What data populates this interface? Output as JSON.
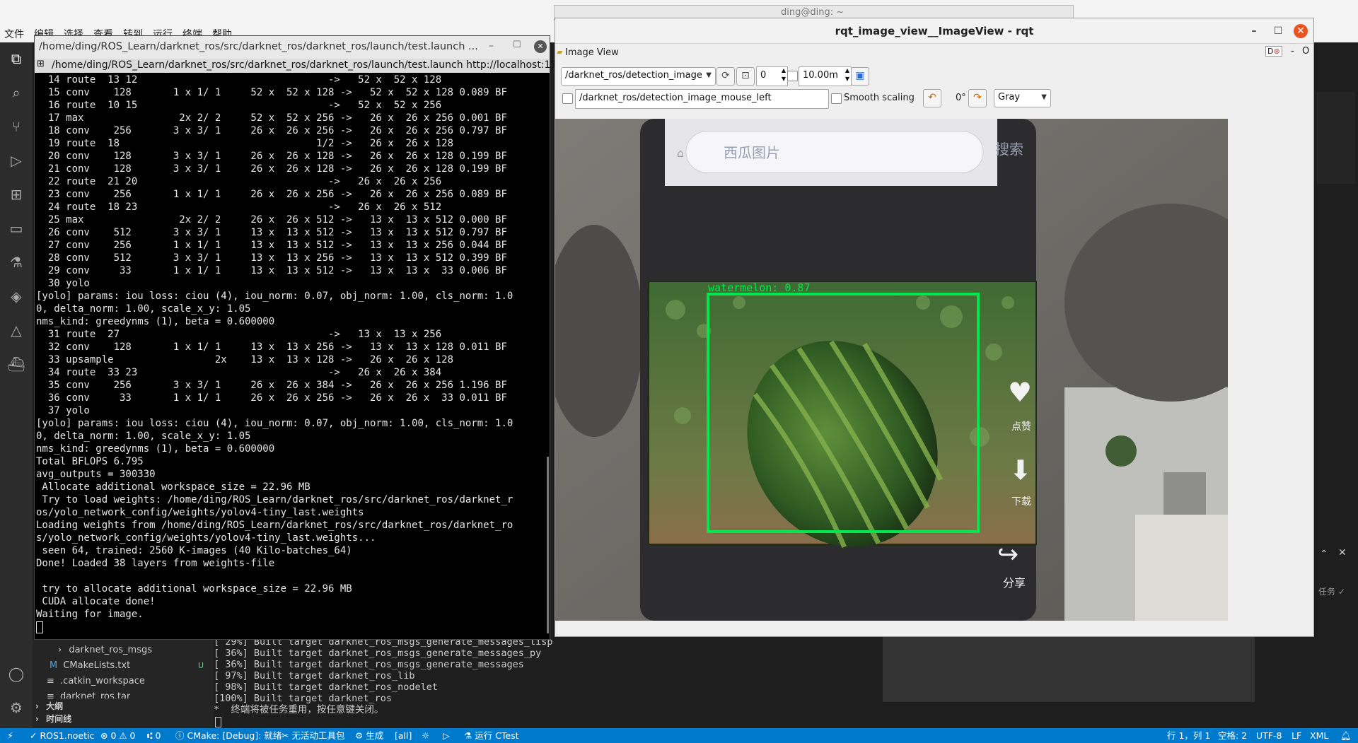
{
  "vscode": {
    "menu": [
      "文件",
      "编辑",
      "选择",
      "查看",
      "转到",
      "运行",
      "终端",
      "帮助"
    ],
    "background_title": "ding@ding: ~",
    "explorer": {
      "items": [
        "darknet_ros_msgs",
        "CMakeLists.txt",
        ".catkin_workspace",
        "darknet_ros.tar"
      ],
      "cmake_badge": "U",
      "sections": [
        "大纲",
        "时间线"
      ]
    },
    "panel_lines": [
      "[ 29%] Built target darknet_ros_msgs_generate_messages_lisp",
      "[ 36%] Built target darknet_ros_msgs_generate_messages_py",
      "[ 36%] Built target darknet_ros_msgs_generate_messages",
      "[ 97%] Built target darknet_ros_lib",
      "[ 98%] Built target darknet_ros_nodelet",
      "[100%] Built target darknet_ros",
      "*  终端将被任务重用，按任意键关闭。"
    ],
    "side_labels": {
      "task": "任务"
    },
    "status": {
      "remote": "⚡",
      "env": "ROS1.noetic",
      "problems": "⊗ 0 ⚠ 0",
      "ports": "⑆ 0",
      "cmake": "CMake: [Debug]: 就绪",
      "kit": "无活动工具包",
      "build": "生成",
      "target": "[all]",
      "ctest": "运行 CTest",
      "position": "行 1，列 1",
      "spaces": "空格: 2",
      "encoding": "UTF-8",
      "eol": "LF",
      "language": "XML"
    }
  },
  "terminal": {
    "title": "/home/ding/ROS_Learn/darknet_ros/src/darknet_ros/darknet_ros/launch/test.launch ...",
    "tab_text": "/home/ding/ROS_Learn/darknet_ros/src/darknet_ros/darknet_ros/launch/test.launch http://localhost:11",
    "lines": [
      "  14 route  13 12                                ->   52 x  52 x 128",
      "  15 conv    128       1 x 1/ 1     52 x  52 x 128 ->   52 x  52 x 128 0.089 BF",
      "  16 route  10 15                                ->   52 x  52 x 256",
      "  17 max                2x 2/ 2     52 x  52 x 256 ->   26 x  26 x 256 0.001 BF",
      "  18 conv    256       3 x 3/ 1     26 x  26 x 256 ->   26 x  26 x 256 0.797 BF",
      "  19 route  18                                 1/2 ->   26 x  26 x 128",
      "  20 conv    128       3 x 3/ 1     26 x  26 x 128 ->   26 x  26 x 128 0.199 BF",
      "  21 conv    128       3 x 3/ 1     26 x  26 x 128 ->   26 x  26 x 128 0.199 BF",
      "  22 route  21 20                                ->   26 x  26 x 256",
      "  23 conv    256       1 x 1/ 1     26 x  26 x 256 ->   26 x  26 x 256 0.089 BF",
      "  24 route  18 23                                ->   26 x  26 x 512",
      "  25 max                2x 2/ 2     26 x  26 x 512 ->   13 x  13 x 512 0.000 BF",
      "  26 conv    512       3 x 3/ 1     13 x  13 x 512 ->   13 x  13 x 512 0.797 BF",
      "  27 conv    256       1 x 1/ 1     13 x  13 x 512 ->   13 x  13 x 256 0.044 BF",
      "  28 conv    512       3 x 3/ 1     13 x  13 x 256 ->   13 x  13 x 512 0.399 BF",
      "  29 conv     33       1 x 1/ 1     13 x  13 x 512 ->   13 x  13 x  33 0.006 BF",
      "  30 yolo",
      "[yolo] params: iou loss: ciou (4), iou_norm: 0.07, obj_norm: 1.00, cls_norm: 1.0",
      "0, delta_norm: 1.00, scale_x_y: 1.05",
      "nms_kind: greedynms (1), beta = 0.600000",
      "  31 route  27                                   ->   13 x  13 x 256",
      "  32 conv    128       1 x 1/ 1     13 x  13 x 256 ->   13 x  13 x 128 0.011 BF",
      "  33 upsample                 2x    13 x  13 x 128 ->   26 x  26 x 128",
      "  34 route  33 23                                ->   26 x  26 x 384",
      "  35 conv    256       3 x 3/ 1     26 x  26 x 384 ->   26 x  26 x 256 1.196 BF",
      "  36 conv     33       1 x 1/ 1     26 x  26 x 256 ->   26 x  26 x  33 0.011 BF",
      "  37 yolo",
      "[yolo] params: iou loss: ciou (4), iou_norm: 0.07, obj_norm: 1.00, cls_norm: 1.0",
      "0, delta_norm: 1.00, scale_x_y: 1.05",
      "nms_kind: greedynms (1), beta = 0.600000",
      "Total BFLOPS 6.795",
      "avg_outputs = 300330",
      " Allocate additional workspace_size = 22.96 MB",
      " Try to load weights: /home/ding/ROS_Learn/darknet_ros/src/darknet_ros/darknet_r",
      "os/yolo_network_config/weights/yolov4-tiny_last.weights",
      "Loading weights from /home/ding/ROS_Learn/darknet_ros/src/darknet_ros/darknet_ro",
      "s/yolo_network_config/weights/yolov4-tiny_last.weights...",
      " seen 64, trained: 2560 K-images (40 Kilo-batches_64)",
      "Done! Loaded 38 layers from weights-file",
      "",
      " try to allocate additional workspace_size = 22.96 MB",
      " CUDA allocate done!",
      "Waiting for image."
    ]
  },
  "rqt": {
    "title": "rqt_image_view__ImageView - rqt",
    "plugin_label": "Image View",
    "plugin_controls": "D",
    "topic": "/darknet_ros/detection_image",
    "spin_value": "0",
    "rate_value": "10.00m",
    "mouse_topic": "/darknet_ros/detection_image_mouse_left",
    "smooth_label": "Smooth scaling",
    "rotation": "0°",
    "color_scheme": "Gray",
    "image": {
      "search_placeholder": "西瓜图片",
      "search_button": "搜索",
      "side_label_1": "点赞",
      "side_label_2": "下载",
      "share_label": "分享",
      "detection_label": "watermelon: 0.87",
      "detection_confidence": 0.87,
      "detection_color": "#00e64d"
    }
  }
}
